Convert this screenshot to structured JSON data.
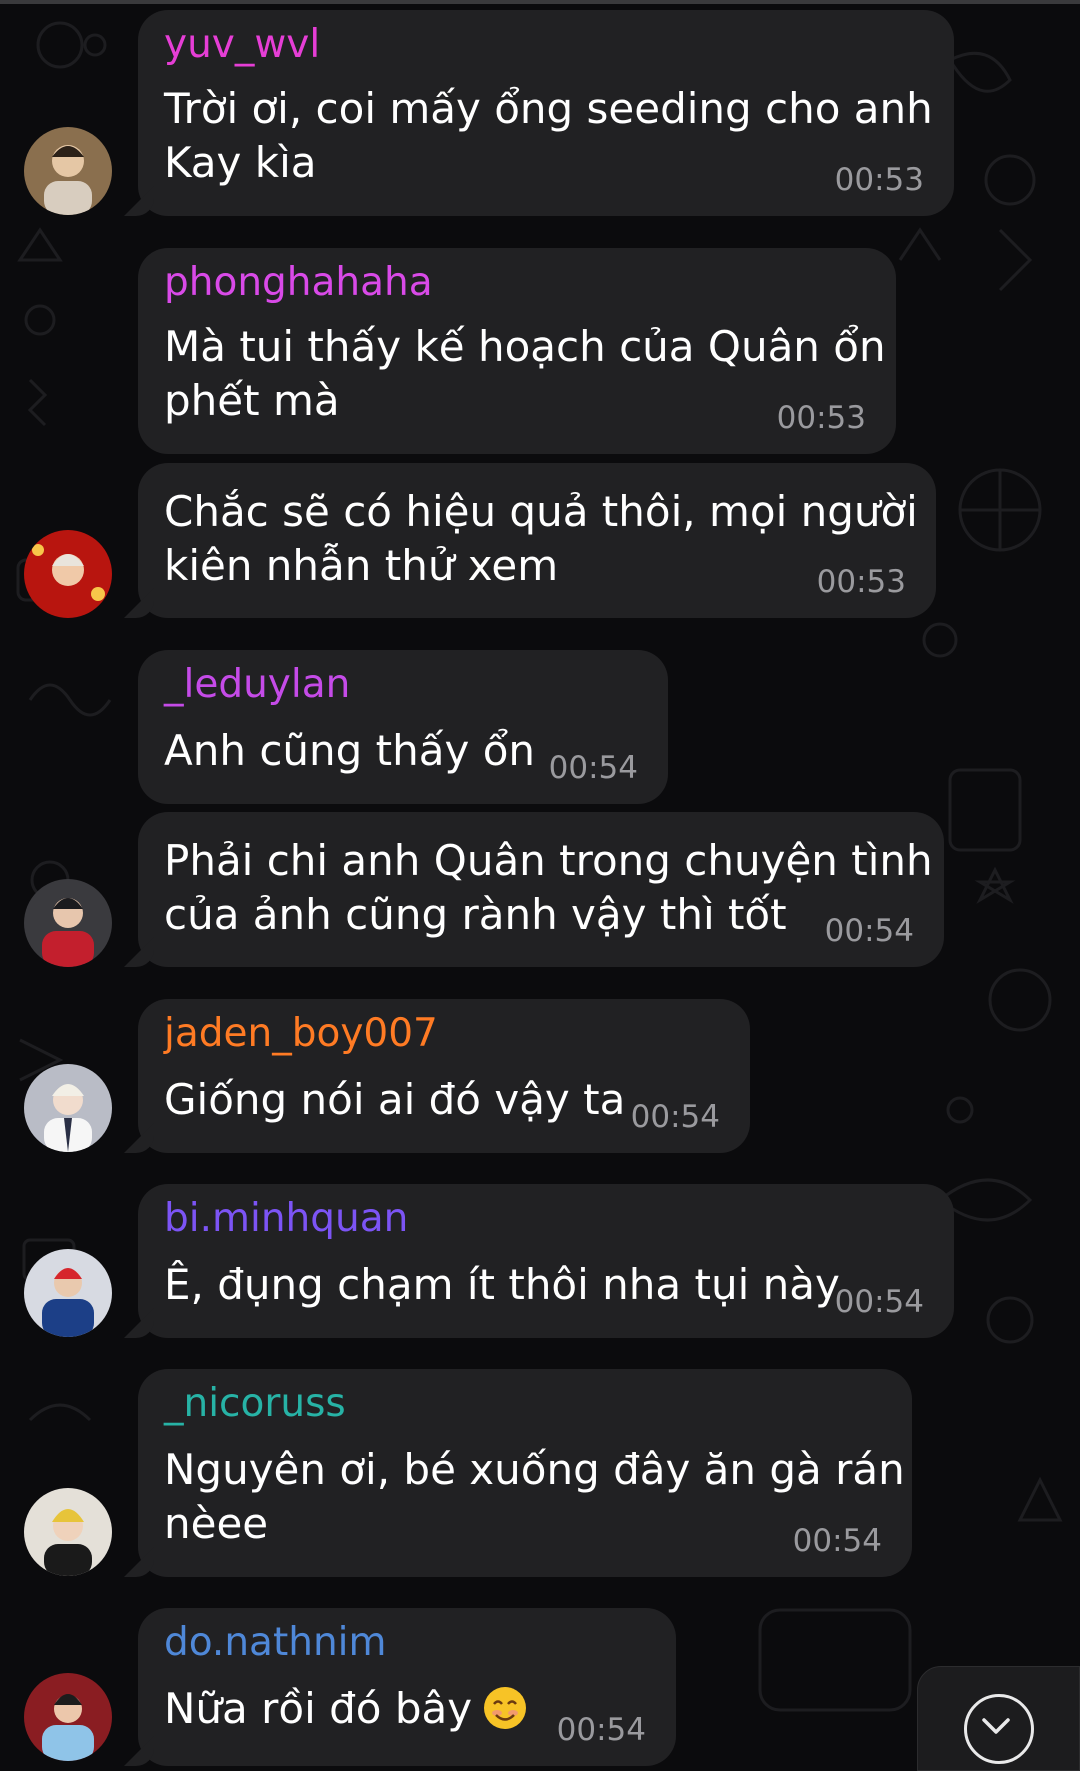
{
  "colors": {
    "background": "#0b0b0d",
    "bubble": "#212123",
    "text": "#ffffff",
    "timestamp": "#9a9a9e",
    "names": {
      "yuv_wvl": "#e63ed6",
      "phonghahaha": "#d94ae8",
      "_leduylan": "#c54be8",
      "jaden_boy007": "#ff7b24",
      "bi.minhquan": "#7c54f5",
      "_nicoruss": "#27b3a6",
      "do.nathnim": "#4f88d8"
    }
  },
  "messages": [
    {
      "sender": "yuv_wvl",
      "lines": [
        "Trời ơi, coi mấy ổng seeding cho anh",
        "Kay kìa"
      ],
      "time": "00:53"
    },
    {
      "sender": "phonghahaha",
      "lines": [
        "Mà tui thấy kế hoạch của Quân ổn",
        "phết mà"
      ],
      "time": "00:53"
    },
    {
      "sender": "",
      "lines": [
        "Chắc sẽ có hiệu quả thôi, mọi người",
        "kiên nhẫn thử xem"
      ],
      "time": "00:53"
    },
    {
      "sender": "_leduylan",
      "lines": [
        "Anh cũng thấy ổn"
      ],
      "time": "00:54"
    },
    {
      "sender": "",
      "lines": [
        "Phải chi anh Quân trong chuyện tình",
        "của ảnh cũng rành vậy thì tốt"
      ],
      "time": "00:54"
    },
    {
      "sender": "jaden_boy007",
      "lines": [
        "Giống nói ai đó vậy ta"
      ],
      "time": "00:54"
    },
    {
      "sender": "bi.minhquan",
      "lines": [
        "Ê, đụng chạm ít thôi nha tụi này"
      ],
      "time": "00:54"
    },
    {
      "sender": "_nicoruss",
      "lines": [
        "Nguyên ơi, bé xuống đây ăn gà rán",
        "nèee"
      ],
      "time": "00:54"
    },
    {
      "sender": "do.nathnim",
      "lines": [
        "Nữa rồi đó bây"
      ],
      "time": "00:54",
      "emoji": "smiling-face"
    }
  ],
  "scroll_button": {
    "icon": "chevron-down-icon"
  }
}
